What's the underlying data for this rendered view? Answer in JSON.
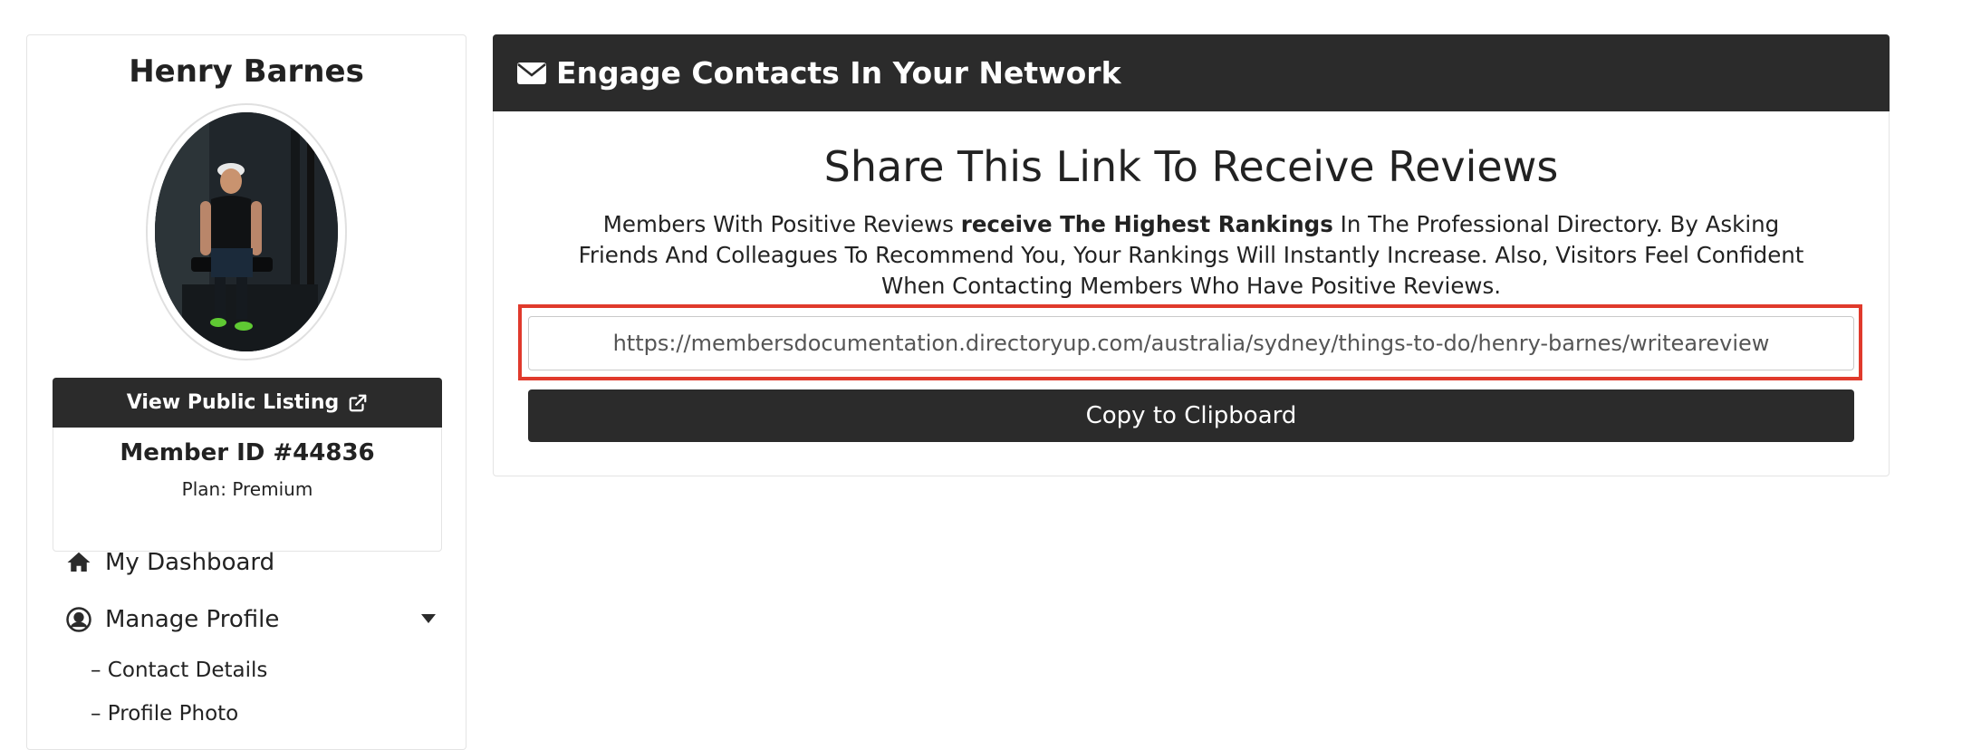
{
  "sidebar": {
    "member_name": "Henry Barnes",
    "avatar_alt": "Henry Barnes profile photo",
    "view_listing_label": "View Public Listing",
    "member_id": "Member ID #44836",
    "plan": "Plan: Premium",
    "nav": {
      "dashboard": "My Dashboard",
      "manage_profile": "Manage Profile",
      "sub_items": [
        "– Contact Details",
        "– Profile Photo"
      ]
    }
  },
  "panel": {
    "header_title": "Engage Contacts In Your Network",
    "share_title": "Share This Link To Receive Reviews",
    "desc": {
      "part1": "Members With Positive Reviews ",
      "bold": "receive The Highest Rankings",
      "part2": " In The Professional Directory. By Asking Friends And Colleagues To Recommend You, Your Rankings Will Instantly Increase. Also, Visitors Feel Confident When Contacting Members Who Have Positive Reviews."
    },
    "review_url": "https://membersdocumentation.directoryup.com/australia/sydney/things-to-do/henry-barnes/writeareview",
    "copy_label": "Copy to Clipboard"
  },
  "colors": {
    "dark": "#2b2b2b",
    "highlight": "#e03a2c",
    "border": "#e4e4e4"
  },
  "icons": {
    "header": "envelope-icon",
    "listing": "external-link-icon",
    "dashboard": "home-icon",
    "manage": "user-circle-icon",
    "caret": "caret-down-icon"
  }
}
